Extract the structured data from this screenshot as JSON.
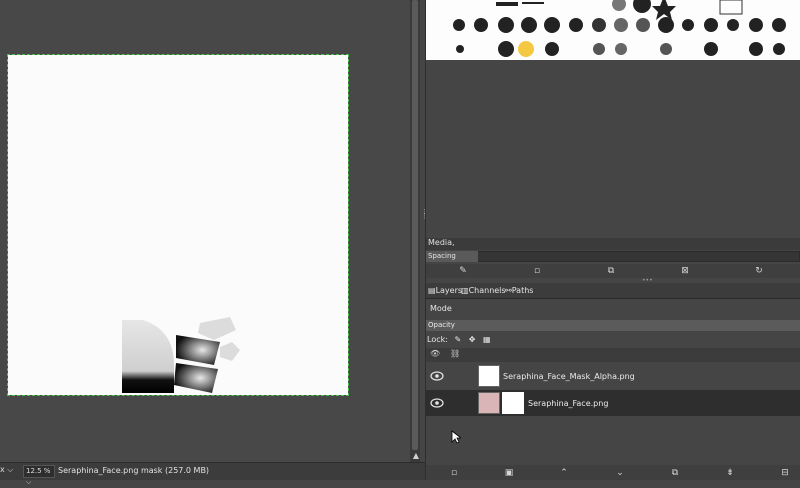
{
  "brushes_panel": {
    "selected_brush_name": "Media,",
    "spacing_label": "Spacing",
    "toolbar_icons": [
      "edit-brush-icon",
      "new-brush-icon",
      "duplicate-brush-icon",
      "delete-brush-icon",
      "refresh-brushes-icon"
    ]
  },
  "layers_panel": {
    "tabs": [
      {
        "label": "Layers",
        "icon": "layers-icon"
      },
      {
        "label": "Channels",
        "icon": "channels-icon"
      },
      {
        "label": "Paths",
        "icon": "paths-icon"
      }
    ],
    "mode_label": "Mode",
    "opacity_label": "Opacity",
    "lock_label": "Lock:",
    "layers": [
      {
        "name": "Seraphina_Face_Mask_Alpha.png",
        "visible": true,
        "selected": false
      },
      {
        "name": "Seraphina_Face.png",
        "visible": true,
        "selected": true
      }
    ],
    "toolbar_icons": [
      "new-layer-icon",
      "new-layer-group-icon",
      "raise-layer-icon",
      "lower-layer-icon",
      "duplicate-layer-icon",
      "anchor-layer-icon",
      "delete-layer-icon"
    ]
  },
  "status_bar": {
    "unit": "x",
    "zoom": "12.5 %",
    "message": "Seraphina_Face.png mask (257.0 MB)"
  },
  "colors": {
    "canvas_border": "#4bbf4b",
    "panel_bg": "#454545",
    "selected_row": "#2e2e2e"
  }
}
